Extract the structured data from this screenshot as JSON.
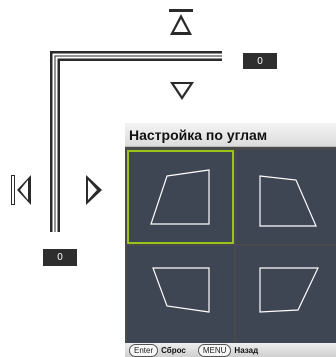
{
  "osd": {
    "vertical_value": "0",
    "horizontal_value": "0"
  },
  "panel": {
    "title": "Настройка по углам",
    "corners": [
      {
        "id": "top-left",
        "selected": true
      },
      {
        "id": "top-right",
        "selected": false
      },
      {
        "id": "bottom-left",
        "selected": false
      },
      {
        "id": "bottom-right",
        "selected": false
      }
    ]
  },
  "footer": {
    "enter_key": "Enter",
    "enter_label": "Сброс",
    "menu_key": "MENU",
    "menu_label": "Назад"
  },
  "colors": {
    "panel_bg": "#4a4a4a",
    "cell_bg": "#3e4553",
    "selected_border": "#9ac31c"
  }
}
